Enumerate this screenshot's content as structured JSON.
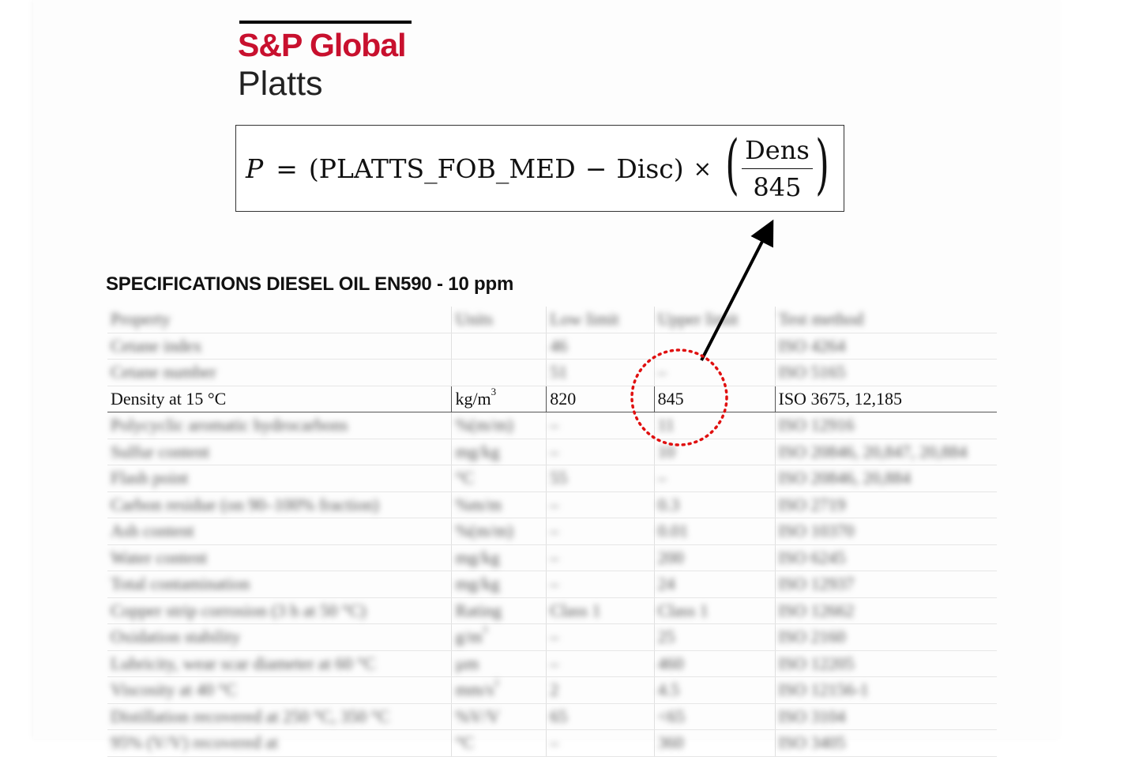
{
  "logo": {
    "brand": "S&P Global",
    "product": "Platts"
  },
  "formula": {
    "lhs": "P",
    "equals": "=",
    "open_paren": "(",
    "term1": "PLATTS_FOB_MED",
    "minus": "−",
    "term2": "Disc",
    "close_paren": ")",
    "times": "×",
    "big_open": "(",
    "numerator": "Dens",
    "denominator": "845",
    "big_close": ")"
  },
  "title": "SPECIFICATIONS DIESEL OIL EN590 - 10 ppm",
  "table": {
    "headers": [
      "Property",
      "Units",
      "Low limit",
      "Upper limit",
      "Test method"
    ],
    "rows": [
      [
        "Cetane index",
        "",
        "46",
        "",
        "ISO 4264"
      ],
      [
        "Cetane number",
        "",
        "51",
        "–",
        "ISO 5165"
      ],
      [
        "Density at 15 °C",
        "kg/m",
        "820",
        "845",
        "ISO 3675, 12,185"
      ],
      [
        "Polycyclic aromatic hydrocarbons",
        "%(m/m)",
        "–",
        "11",
        "ISO 12916"
      ],
      [
        "Sulfur content",
        "mg/kg",
        "–",
        "10",
        "ISO 20846, 20,847, 20,884"
      ],
      [
        "Flash point",
        "°C",
        "55",
        "–",
        "ISO 20846, 20,884"
      ],
      [
        "Carbon residue (on 90–100% fraction)",
        "%m/m",
        "–",
        "0.3",
        "ISO 2719"
      ],
      [
        "Ash content",
        "%(m/m)",
        "–",
        "0.01",
        "ISO 10370"
      ],
      [
        "Water content",
        "mg/kg",
        "–",
        "200",
        "ISO 6245"
      ],
      [
        "Total contamination",
        "mg/kg",
        "–",
        "24",
        "ISO 12937"
      ],
      [
        "Copper strip corrosion (3 h at 50 °C)",
        "Rating",
        "Class 1",
        "Class 1",
        "ISO 12662"
      ],
      [
        "Oxidation stability",
        "g/m",
        "–",
        "25",
        "ISO 2160"
      ],
      [
        "Lubricity, wear scar diameter at 60 °C",
        "µm",
        "–",
        "460",
        "ISO 12205"
      ],
      [
        "Viscosity at 40 °C",
        "mm/s",
        "2",
        "4.5",
        "ISO 12156-1"
      ],
      [
        "Distillation recovered at 250 °C, 350 °C",
        "%V/V",
        "65",
        "<65",
        "ISO 3104"
      ],
      [
        "95% (V/V) recovered at",
        "°C",
        "–",
        "360",
        "ISO 3405"
      ]
    ],
    "density_unit_sup": "3",
    "oxidation_unit_sup": "3",
    "viscosity_unit_sup": "2"
  },
  "colors": {
    "brand_red": "#c8102e",
    "highlight_circle": "#e01010",
    "arrow": "#000000"
  }
}
